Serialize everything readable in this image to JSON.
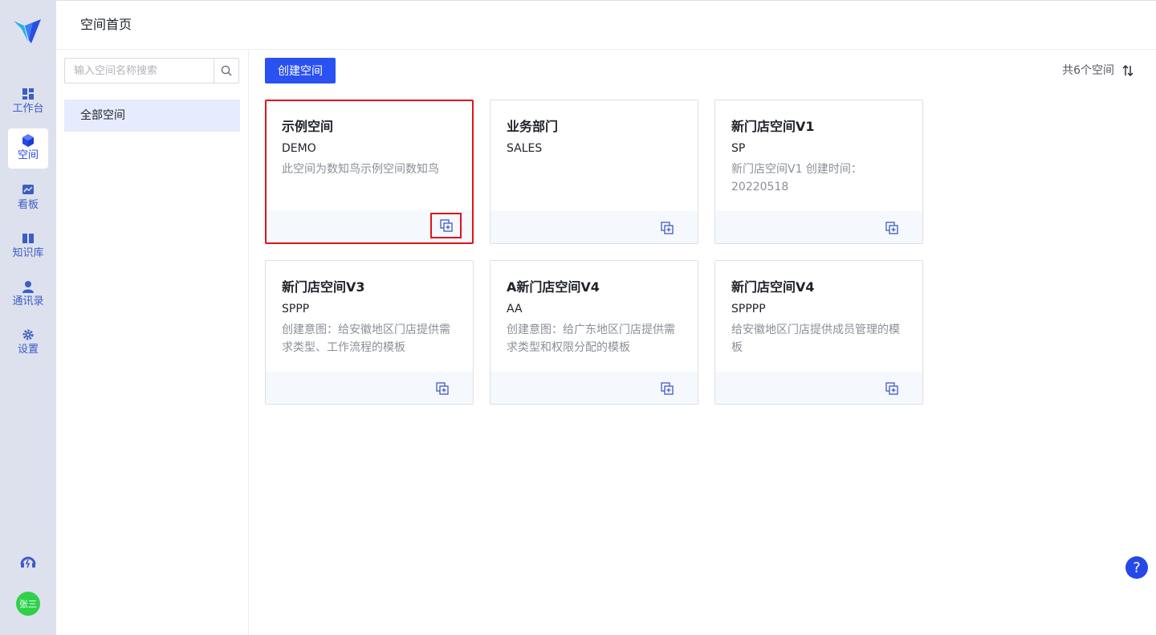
{
  "rail": {
    "items": [
      {
        "label": "工作台",
        "icon": "dashboard-icon"
      },
      {
        "label": "空间",
        "icon": "cube-icon",
        "active": true
      },
      {
        "label": "看板",
        "icon": "chart-board-icon"
      },
      {
        "label": "知识库",
        "icon": "book-icon"
      },
      {
        "label": "通讯录",
        "icon": "contact-icon"
      },
      {
        "label": "设置",
        "icon": "gear-icon"
      }
    ],
    "avatar": "张三"
  },
  "header": {
    "title": "空间首页"
  },
  "sidebar": {
    "search_placeholder": "输入空间名称搜索",
    "tree_item": "全部空间"
  },
  "main": {
    "create_label": "创建空间",
    "count_label": "共6个空间",
    "cards": [
      {
        "title": "示例空间",
        "code": "DEMO",
        "desc": "此空间为数知鸟示例空间数知鸟"
      },
      {
        "title": "业务部门",
        "code": "SALES",
        "desc": ""
      },
      {
        "title": "新门店空间V1",
        "code": "SP",
        "desc": "新门店空间V1 创建时间：20220518"
      },
      {
        "title": "新门店空间V3",
        "code": "SPPP",
        "desc": "创建意图：给安徽地区门店提供需求类型、工作流程的模板"
      },
      {
        "title": "A新门店空间V4",
        "code": "AA",
        "desc": "创建意图：给广东地区门店提供需求类型和权限分配的模板"
      },
      {
        "title": "新门店空间V4",
        "code": "SPPPP",
        "desc": "给安徽地区门店提供成员管理的模板"
      }
    ]
  },
  "help": "?",
  "colors": {
    "accent": "#2a52f2",
    "highlight": "#e0141b",
    "rail_bg": "#dde1ee"
  }
}
